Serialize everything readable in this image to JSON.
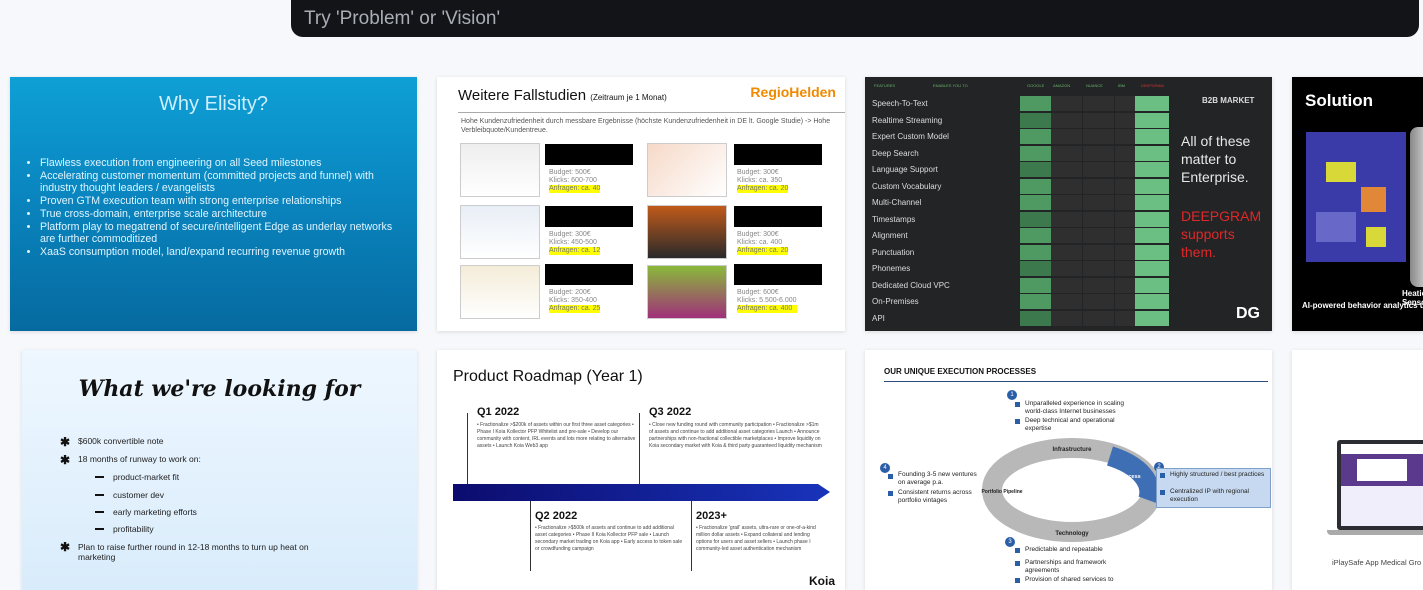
{
  "search": {
    "placeholder": "Try 'Problem' or 'Vision'"
  },
  "cards": {
    "elisity": {
      "title": "Why Elisity?",
      "bullets": [
        "Flawless execution from engineering on all Seed milestones",
        "Accelerating customer momentum (committed projects and funnel) with industry thought leaders / evangelists",
        "Proven GTM execution team with strong enterprise relationships",
        "True cross-domain, enterprise scale architecture",
        "Platform play to megatrend of secure/intelligent Edge as underlay networks are further commoditized",
        "XaaS consumption model, land/expand recurring revenue growth"
      ]
    },
    "regio": {
      "title": "Weitere Fallstudien",
      "title_note": "(Zeitraum je 1 Monat)",
      "logo": "RegioHelden",
      "subtitle": "Hohe Kundenzufriedenheit durch messbare Ergebnisse (höchste Kundenzufriedenheit in DE lt. Google Studie) -> Hohe Verbleibquote/Kundentreue.",
      "cases": [
        {
          "budget": "Budget: 500€",
          "clicks": "Klicks: 600-700",
          "requests": "Anfragen: ca. 40"
        },
        {
          "budget": "Budget: 300€",
          "clicks": "Klicks: ca. 350",
          "requests": "Anfragen: ca. 20"
        },
        {
          "budget": "Budget: 300€",
          "clicks": "Klicks: 450-500",
          "requests": "Anfragen: ca. 12"
        },
        {
          "budget": "Budget: 300€",
          "clicks": "Klicks: ca. 400",
          "requests": "Anfragen: ca. 20"
        },
        {
          "budget": "Budget: 200€",
          "clicks": "Klicks: 350-400",
          "requests": "Anfragen: ca. 25"
        },
        {
          "budget": "Budget: 600€",
          "clicks": "Klicks: 5.500-6.000",
          "requests": "Anfragen: ca. 400"
        }
      ]
    },
    "deepgram": {
      "header_features": "FEATURES",
      "header_enables": "ENABLES YOU TO",
      "columns": [
        "GOOGLE",
        "AMAZON",
        "NUANCE",
        "IBM",
        "DEEPGRAM"
      ],
      "market_label": "B2B MARKET",
      "side_text_1": "All of these matter to Enterprise.",
      "side_text_2": "DEEPGRAM supports them.",
      "mark": "DG",
      "features": [
        "Speech-To-Text",
        "Realtime Streaming",
        "Expert Custom Model",
        "Deep Search",
        "Language Support",
        "Custom Vocabulary",
        "Multi-Channel",
        "Timestamps",
        "Alignment",
        "Punctuation",
        "Phonemes",
        "Dedicated Cloud VPC",
        "On-Premises",
        "API"
      ]
    },
    "heatic": {
      "title": "Solution",
      "sensor": "Heatic™ Sensor",
      "caption": "AI-powered behavior analytics using"
    },
    "looking": {
      "title": "What we're looking for",
      "items": [
        "$600k convertible note",
        "18 months of runway to work on:",
        "product-market fit",
        "customer dev",
        "early marketing efforts",
        "profitability",
        "Plan to raise further round in 12-18 months to turn up heat on marketing"
      ]
    },
    "roadmap": {
      "title": "Product Roadmap (Year 1)",
      "q1": "Q1 2022",
      "q3": "Q3 2022",
      "q2": "Q2 2022",
      "q4": "2023+",
      "q1_text": "• Fractionalize >$200k of assets within our first three asset categories • Phase I Koia Kollector PFP Whitelist and pre-sale • Develop our community with content, IRL events and lots more relating to alternative assets • Launch Koia Web3 app",
      "q3_text": "• Close new funding round with community participation • Fractionalize >$1m of assets and continue to add additional asset categories Launch • Announce partnerships with non-fractional collectible marketplaces • Improve liquidity on Koia secondary market with Koia & third party guaranteed liquidity mechanism",
      "q2_text": "• Fractionalize >$500k of assets and continue to add additional asset categories • Phase II Koia Kollector PFP sale • Launch secondary market trading on Koia app • Early access to token sale or crowdfunding campaign",
      "q4_text": "• Fractionalize 'grail' assets, ultra-rare or one-of-a-kind million dollar assets • Expand collateral and lending options for users and asset sellers • Launch phase I community-led asset authentication mechanism",
      "logo": "Koia"
    },
    "execution": {
      "title": "OUR UNIQUE EXECUTION PROCESSES",
      "top": [
        "Unparalleled experience in scaling world-class Internet businesses",
        "Deep technical and operational expertise"
      ],
      "left": [
        "Founding 3-5 new ventures on average p.a.",
        "Consistent returns across portfolio vintages"
      ],
      "right": [
        "Highly structured / best practices",
        "Centralized IP with regional execution"
      ],
      "bottom": [
        "Predictable and repeatable",
        "Partnerships and framework agreements",
        "Provision of shared services to"
      ],
      "ring_labels": [
        "Infrastructure",
        "Process",
        "Technology",
        "Portfolio Pipeline"
      ],
      "numbers": [
        "1",
        "2",
        "3",
        "4"
      ]
    },
    "iplaysafe": {
      "caption": "iPlaySafe App Medical Gro"
    }
  }
}
